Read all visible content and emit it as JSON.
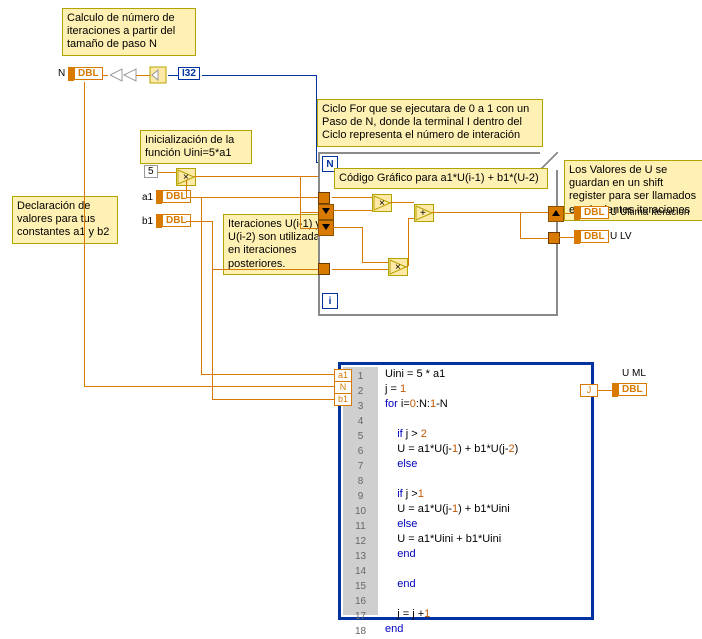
{
  "comments": {
    "calc": "Calculo de número de iteraciones a partir del tamaño de paso N",
    "init": "Inicialización de la función Uini=5*a1",
    "decl": "Declaración de valores para tus constantes a1 y b2",
    "iter": "Iteraciones U(i-1) y U(i-2) son utilizadas en iteraciones posteriores.",
    "forloop": "Ciclo For que se ejecutara de 0 a 1 con un Paso de N, donde la terminal I dentro del Ciclo representa el número de interación",
    "codigo": "Código Gráfico para a1*U(i-1) + b1*(U-2)",
    "shiftreg": "Los Valores de U se guardan en un shift register para ser llamados en siguientes iteraciones"
  },
  "terminals": {
    "N": "N",
    "a1": "a1",
    "b1": "b1",
    "dbl": "DBL",
    "i32": "I32",
    "five": "5",
    "u_ultima": "U Ultima Iteracion",
    "u_lv": "U LV",
    "u_ml": "U ML"
  },
  "loop": {
    "N": "N",
    "i": "i"
  },
  "script_io": {
    "a1": "a1",
    "N": "N",
    "b1": "b1",
    "J": "J"
  },
  "code_lines": {
    "1": "Uini = 5 * a1",
    "2": "j = 1",
    "3_a": "for ",
    "3_b": "i=",
    "3_c": "0",
    "3_d": ":N:",
    "3_e": "1",
    "3_f": "-N",
    "4": "",
    "5_a": "    if ",
    "5_b": "j > ",
    "5_c": "2",
    "6_a": "    U = a1*U(j-",
    "6_b": "1",
    "6_c": ") + b1*U(j-",
    "6_d": "2",
    "6_e": ")",
    "7": "    else",
    "8": "",
    "9_a": "    if ",
    "9_b": "j >",
    "9_c": "1",
    "10_a": "    U = a1*U(j-",
    "10_b": "1",
    "10_c": ") + b1*Uini",
    "11": "    else",
    "12": "    U = a1*Uini + b1*Uini",
    "13": "    end",
    "14": "",
    "15": "    end",
    "16": "",
    "17_a": "    j = j +",
    "17_b": "1",
    "18": "end"
  }
}
